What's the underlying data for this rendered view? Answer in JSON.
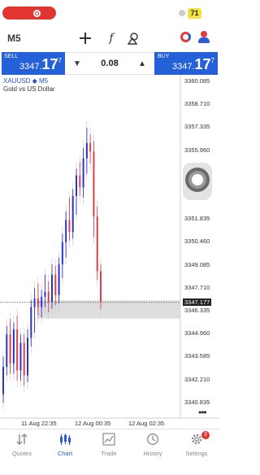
{
  "status_bar": {
    "battery_level": "71"
  },
  "toolbar": {
    "timeframe": "M5",
    "function_symbol": "f"
  },
  "trade": {
    "sell_label": "SELL",
    "sell_price_small": "3347.",
    "sell_price_big": "17",
    "sell_price_sup": "7",
    "buy_label": "BUY",
    "buy_price_small": "3347.",
    "buy_price_big": "17",
    "buy_price_sup": "7",
    "volume": "0.08"
  },
  "chart": {
    "symbol": "XAUUSD",
    "period_sep": " ◆ ",
    "period": "M5",
    "description": "Gold vs US Dollar",
    "y_ticks": [
      "3360.085",
      "3358.710",
      "3357.335",
      "3355.960",
      "3354.585",
      "3353.210",
      "3351.835",
      "3350.460",
      "3349.085",
      "3347.710",
      "3346.335",
      "3344.960",
      "3343.585",
      "3342.210",
      "3340.835"
    ],
    "current_price": "3347.177",
    "x_ticks": [
      "11 Aug 22:35",
      "12 Aug 00:35",
      "12 Aug 02:35"
    ],
    "more_label": "•••"
  },
  "chart_data": {
    "type": "candlestick",
    "symbol": "XAUUSD",
    "timeframe": "M5",
    "ylim": [
      3340.5,
      3360.3
    ],
    "current_price": 3347.177,
    "x_ticks": [
      "11 Aug 22:35",
      "12 Aug 00:35",
      "12 Aug 02:35"
    ],
    "colors": {
      "bull": "#2a34c8",
      "bear": "#d9404a",
      "wick_bg": "#c8c8c8"
    },
    "candles": [
      {
        "o": 3341.8,
        "h": 3344.0,
        "l": 3341.3,
        "c": 3343.4
      },
      {
        "o": 3343.4,
        "h": 3345.8,
        "l": 3342.9,
        "c": 3345.3
      },
      {
        "o": 3345.3,
        "h": 3346.2,
        "l": 3343.0,
        "c": 3343.6
      },
      {
        "o": 3343.6,
        "h": 3346.0,
        "l": 3343.0,
        "c": 3345.6
      },
      {
        "o": 3345.6,
        "h": 3346.4,
        "l": 3342.6,
        "c": 3343.2
      },
      {
        "o": 3343.2,
        "h": 3345.3,
        "l": 3342.6,
        "c": 3344.8
      },
      {
        "o": 3344.8,
        "h": 3345.3,
        "l": 3342.3,
        "c": 3342.9
      },
      {
        "o": 3342.9,
        "h": 3345.6,
        "l": 3342.5,
        "c": 3345.1
      },
      {
        "o": 3345.1,
        "h": 3347.3,
        "l": 3344.6,
        "c": 3346.9
      },
      {
        "o": 3346.9,
        "h": 3348.0,
        "l": 3345.4,
        "c": 3347.4
      },
      {
        "o": 3347.4,
        "h": 3348.3,
        "l": 3346.4,
        "c": 3346.9
      },
      {
        "o": 3346.9,
        "h": 3347.9,
        "l": 3346.3,
        "c": 3347.5
      },
      {
        "o": 3347.5,
        "h": 3348.8,
        "l": 3346.9,
        "c": 3347.8
      },
      {
        "o": 3347.8,
        "h": 3348.4,
        "l": 3346.6,
        "c": 3347.2
      },
      {
        "o": 3347.2,
        "h": 3349.4,
        "l": 3346.8,
        "c": 3348.8
      },
      {
        "o": 3348.8,
        "h": 3349.3,
        "l": 3347.0,
        "c": 3347.6
      },
      {
        "o": 3347.6,
        "h": 3349.8,
        "l": 3347.1,
        "c": 3349.4
      },
      {
        "o": 3349.4,
        "h": 3351.2,
        "l": 3348.6,
        "c": 3350.7
      },
      {
        "o": 3350.7,
        "h": 3352.5,
        "l": 3349.8,
        "c": 3352.0
      },
      {
        "o": 3352.0,
        "h": 3353.3,
        "l": 3350.8,
        "c": 3351.3
      },
      {
        "o": 3351.3,
        "h": 3353.8,
        "l": 3350.9,
        "c": 3353.4
      },
      {
        "o": 3353.4,
        "h": 3355.0,
        "l": 3352.3,
        "c": 3354.6
      },
      {
        "o": 3354.6,
        "h": 3355.4,
        "l": 3353.4,
        "c": 3353.9
      },
      {
        "o": 3353.9,
        "h": 3356.2,
        "l": 3353.3,
        "c": 3355.6
      },
      {
        "o": 3355.6,
        "h": 3357.4,
        "l": 3354.7,
        "c": 3356.5
      },
      {
        "o": 3356.5,
        "h": 3357.0,
        "l": 3355.3,
        "c": 3356.0
      },
      {
        "o": 3356.0,
        "h": 3356.6,
        "l": 3351.0,
        "c": 3352.2
      },
      {
        "o": 3352.2,
        "h": 3352.8,
        "l": 3348.5,
        "c": 3349.0
      },
      {
        "o": 3349.0,
        "h": 3349.4,
        "l": 3346.8,
        "c": 3347.2
      }
    ]
  },
  "nav": {
    "items": [
      {
        "label": "Quotes",
        "icon": "quotes-icon",
        "active": false
      },
      {
        "label": "Chart",
        "icon": "chart-icon",
        "active": true
      },
      {
        "label": "Trade",
        "icon": "trade-icon",
        "active": false
      },
      {
        "label": "History",
        "icon": "history-icon",
        "active": false
      },
      {
        "label": "Settings",
        "icon": "settings-icon",
        "active": false,
        "badge": "3"
      }
    ]
  }
}
